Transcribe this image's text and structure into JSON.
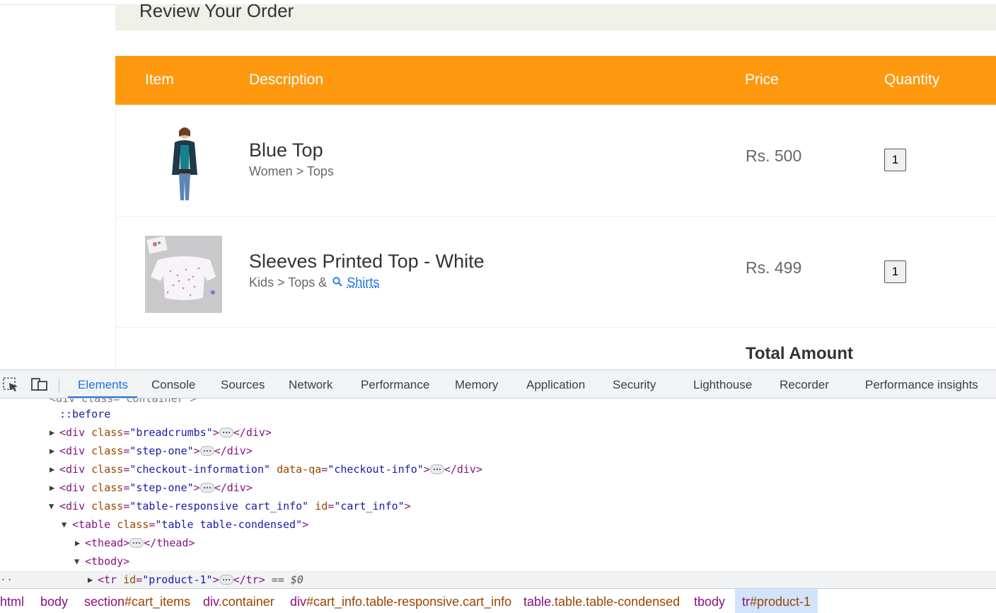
{
  "page": {
    "review_title": "Review Your Order",
    "columns": {
      "item": "Item",
      "description": "Description",
      "price": "Price",
      "quantity": "Quantity"
    },
    "products": [
      {
        "name": "Blue Top",
        "category": "Women > Tops",
        "price": "Rs. 500",
        "quantity": "1"
      },
      {
        "name": "Sleeves Printed Top - White",
        "category_prefix": "Kids > Tops &",
        "category_link": "Shirts",
        "price": "Rs. 499",
        "quantity": "1"
      }
    ],
    "total_label": "Total Amount"
  },
  "devtools": {
    "tabs": [
      "Elements",
      "Console",
      "Sources",
      "Network",
      "Performance",
      "Memory",
      "Application",
      "Security",
      "Lighthouse",
      "Recorder",
      "Performance insights"
    ],
    "active_tab": "Elements",
    "dom": {
      "line0": "<div class=\"container\">",
      "line1": "::before",
      "line2": {
        "tag_open": "<div",
        "attr": "class",
        "value": "\"breadcrumbs\"",
        "tag_close": "</div>"
      },
      "line3": {
        "tag_open": "<div",
        "attr": "class",
        "value": "\"step-one\"",
        "tag_close": "</div>"
      },
      "line4": {
        "tag_open": "<div",
        "attr": "class",
        "value": "\"checkout-information\"",
        "attr2": "data-qa",
        "value2": "\"checkout-info\"",
        "tag_close": "</div>"
      },
      "line5": {
        "tag_open": "<div",
        "attr": "class",
        "value": "\"step-one\"",
        "tag_close": "</div>"
      },
      "line6": {
        "tag_open": "<div",
        "attr": "class",
        "value": "\"table-responsive cart_info\"",
        "attr2": "id",
        "value2": "\"cart_info\"",
        "tag_end": ">"
      },
      "line7": {
        "tag_open": "<table",
        "attr": "class",
        "value": "\"table table-condensed\"",
        "tag_end": ">"
      },
      "line8": {
        "tag_open": "<thead>",
        "tag_close": "</thead>"
      },
      "line9": {
        "tag_open": "<tbody>"
      },
      "line10": {
        "tag_open": "<tr",
        "attr": "id",
        "value": "\"product-1\"",
        "tag_close": "</tr>",
        "marker": "== $0"
      }
    },
    "breadcrumbs": [
      {
        "tag": "html",
        "rest": ""
      },
      {
        "tag": "body",
        "rest": ""
      },
      {
        "tag": "section",
        "rest": "#cart_items"
      },
      {
        "tag": "div",
        "rest": ".container"
      },
      {
        "tag": "div",
        "rest": "#cart_info.table-responsive.cart_info"
      },
      {
        "tag": "table",
        "rest": ".table.table-condensed"
      },
      {
        "tag": "tbody",
        "rest": ""
      },
      {
        "tag": "tr",
        "rest": "#product-1"
      }
    ]
  },
  "colors": {
    "accent": "#fe980f",
    "devtools_blue": "#1a73e8",
    "tag": "#881280",
    "attr": "#994500",
    "value": "#1a1aa6"
  },
  "icons": [
    "inspect-element-icon",
    "device-toolbar-icon",
    "search-icon"
  ]
}
